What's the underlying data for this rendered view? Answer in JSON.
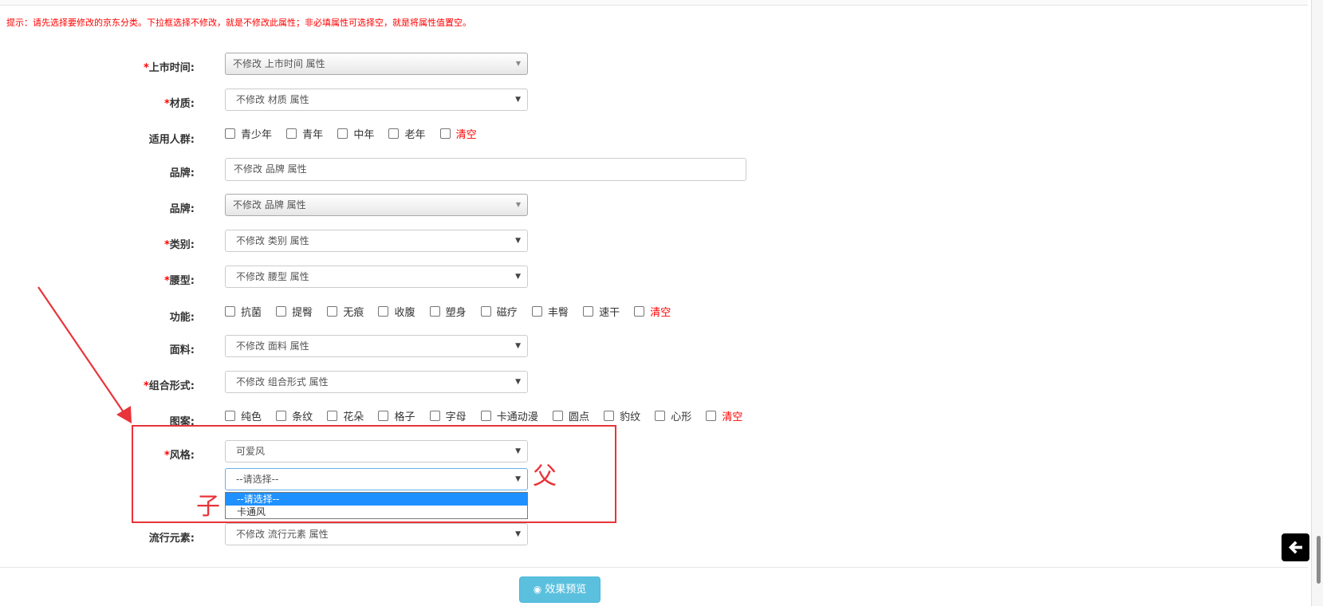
{
  "tip": "提示：请先选择要修改的京东分类。下拉框选择不修改，就是不修改此属性；非必填属性可选择空，就是将属性值置空。",
  "required_mark": "*",
  "fields": {
    "launch_time": {
      "label": "上市时间:",
      "value": "不修改 上市时间 属性"
    },
    "material": {
      "label": "材质:",
      "value": "不修改 材质 属性"
    },
    "audience": {
      "label": "适用人群:",
      "options": [
        "青少年",
        "青年",
        "中年",
        "老年"
      ],
      "clear": "清空"
    },
    "brand_text": {
      "label": "品牌:",
      "value": "不修改 品牌 属性"
    },
    "brand_select": {
      "label": "品牌:",
      "value": "不修改 品牌 属性"
    },
    "category": {
      "label": "类别:",
      "value": "不修改 类别 属性"
    },
    "waist": {
      "label": "腰型:",
      "value": "不修改 腰型 属性"
    },
    "function": {
      "label": "功能:",
      "options": [
        "抗菌",
        "提臀",
        "无痕",
        "收腹",
        "塑身",
        "磁疗",
        "丰臀",
        "速干"
      ],
      "clear": "清空"
    },
    "fabric": {
      "label": "面料:",
      "value": "不修改 面料 属性"
    },
    "combination": {
      "label": "组合形式:",
      "value": "不修改 组合形式 属性"
    },
    "pattern": {
      "label": "图案:",
      "options": [
        "纯色",
        "条纹",
        "花朵",
        "格子",
        "字母",
        "卡通动漫",
        "圆点",
        "豹纹",
        "心形"
      ],
      "clear": "清空"
    },
    "style": {
      "label": "风格:",
      "parent_value": "可爱风",
      "child_value": "--请选择--",
      "child_options": [
        "--请选择--",
        "卡通风"
      ],
      "child_selected_index": 0
    },
    "trend": {
      "label": "流行元素:",
      "value": "不修改 流行元素 属性"
    }
  },
  "annotations": {
    "parent": "父",
    "child": "子",
    "color": "#e8343a"
  },
  "preview_button": {
    "label": "效果预览",
    "icon": "eye-icon"
  },
  "back_button": {
    "icon": "arrow-left-icon"
  },
  "colors": {
    "tip": "#ff0000",
    "required": "#ff0000",
    "clear": "#ff0000",
    "preview_button": "#5bc0de",
    "dropdown_selected": "#1e90ff"
  }
}
